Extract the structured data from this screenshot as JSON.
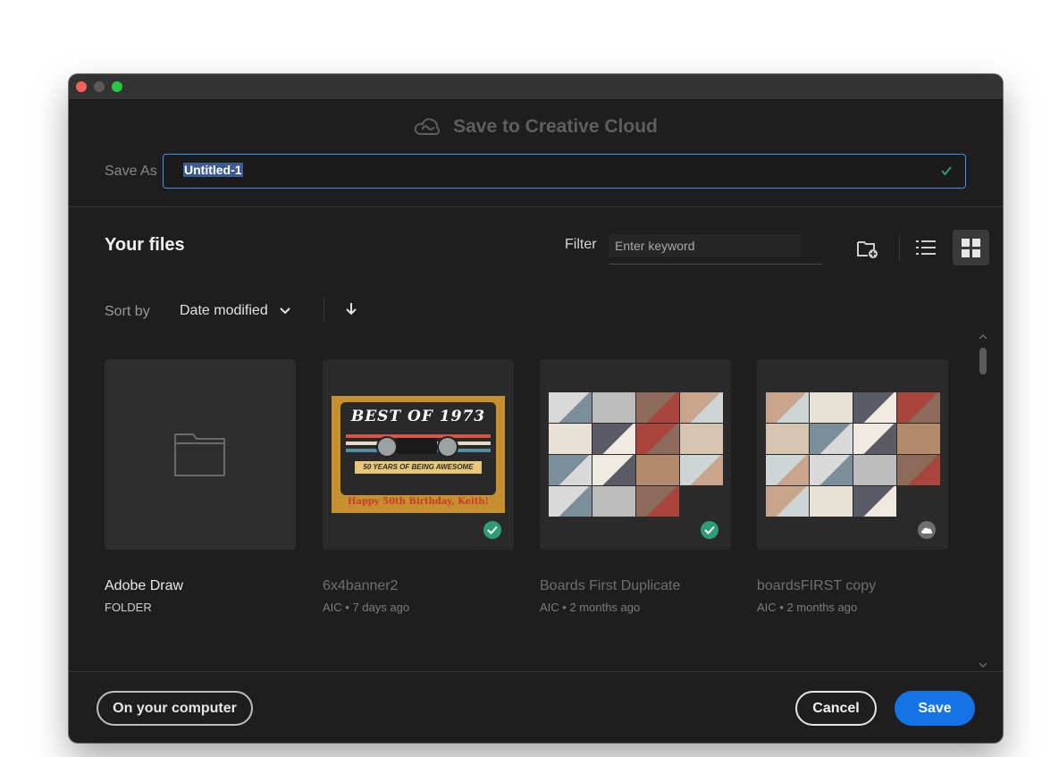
{
  "dialog": {
    "title": "Save to Creative Cloud",
    "save_as_label": "Save As",
    "save_as_value": "Untitled-1"
  },
  "files": {
    "heading": "Your files",
    "filter_label": "Filter",
    "filter_placeholder": "Enter keyword",
    "sort_label": "Sort by",
    "sort_value": "Date modified",
    "items": [
      {
        "name": "Adobe Draw",
        "meta": "FOLDER",
        "type": "folder"
      },
      {
        "name": "6x4banner2",
        "meta": "AIC • 7 days ago",
        "type": "file",
        "status": "synced"
      },
      {
        "name": "Boards First Duplicate",
        "meta": "AIC • 2 months ago",
        "type": "file",
        "status": "synced"
      },
      {
        "name": "boardsFIRST copy",
        "meta": "AIC • 2 months ago",
        "type": "file",
        "status": "cloud"
      }
    ]
  },
  "thumbnail_text": {
    "cassette_title": "BEST OF 1973",
    "cassette_label": "50 YEARS OF BEING AWESOME",
    "cassette_footer": "Happy 50th Birthday, Keith!"
  },
  "footer": {
    "computer_label": "On your computer",
    "cancel_label": "Cancel",
    "save_label": "Save"
  },
  "colors": {
    "accent": "#1473e6",
    "synced": "#2d9d78",
    "background": "#1e1e1e"
  }
}
